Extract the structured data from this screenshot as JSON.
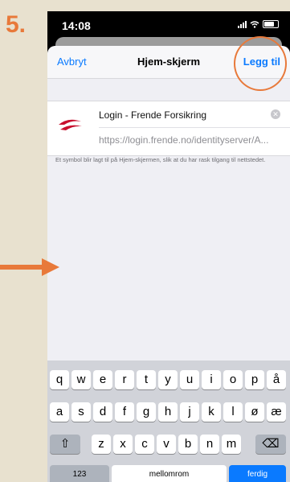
{
  "step": {
    "number": "5."
  },
  "status_bar": {
    "time": "14:08"
  },
  "navbar": {
    "cancel_label": "Avbryt",
    "title": "Hjem-skjerm",
    "add_label": "Legg til"
  },
  "shortcut": {
    "name": "Login - Frende Forsikring",
    "url": "https://login.frende.no/identityserver/A..."
  },
  "info_text": "Et symbol blir lagt til på Hjem-skjermen, slik at du har rask tilgang til nettstedet.",
  "keyboard": {
    "row1": [
      "q",
      "w",
      "e",
      "r",
      "t",
      "y",
      "u",
      "i",
      "o",
      "p",
      "å"
    ],
    "row2": [
      "a",
      "s",
      "d",
      "f",
      "g",
      "h",
      "j",
      "k",
      "l",
      "ø",
      "æ"
    ],
    "row3": [
      "z",
      "x",
      "c",
      "v",
      "b",
      "n",
      "m"
    ],
    "numbers_label": "123",
    "space_label": "mellomrom",
    "done_label": "ferdig"
  },
  "colors": {
    "accent": "#0a7aff",
    "annotation": "#e8793a",
    "logo_red": "#c8102e"
  }
}
